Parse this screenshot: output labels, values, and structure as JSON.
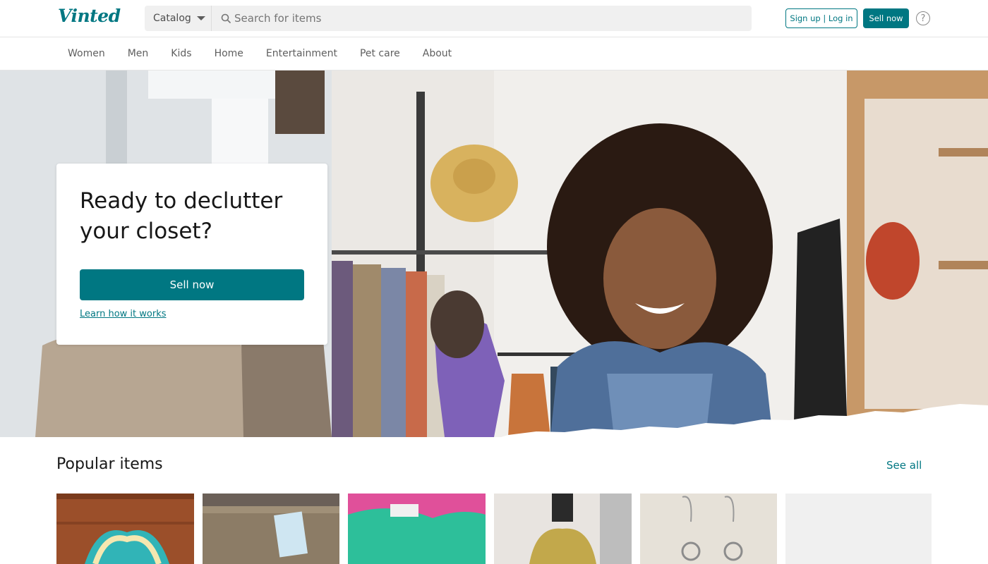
{
  "header": {
    "logo": "Vinted",
    "catalog_label": "Catalog",
    "search_placeholder": "Search for items",
    "signup_login_label": "Sign up | Log in",
    "sell_now_label": "Sell now",
    "help_symbol": "?"
  },
  "nav": {
    "items": [
      "Women",
      "Men",
      "Kids",
      "Home",
      "Entertainment",
      "Pet care",
      "About"
    ]
  },
  "hero": {
    "title": "Ready to declutter your closet?",
    "button_label": "Sell now",
    "link_label": "Learn how it works"
  },
  "popular": {
    "title": "Popular items",
    "see_all_label": "See all",
    "items": [
      {
        "subject": "tank top on wood floor"
      },
      {
        "subject": "khaki trousers with tag"
      },
      {
        "subject": "mint knit sweater"
      },
      {
        "subject": "yellow embroidered blouse"
      },
      {
        "subject": "silver hoop earrings"
      },
      {
        "subject": "placeholder"
      }
    ]
  },
  "colors": {
    "brand": "#007782",
    "nav_text": "#5f5f5f",
    "border": "#e5e5e5"
  },
  "icons": [
    "search-icon",
    "chevron-down-icon",
    "help-icon"
  ]
}
